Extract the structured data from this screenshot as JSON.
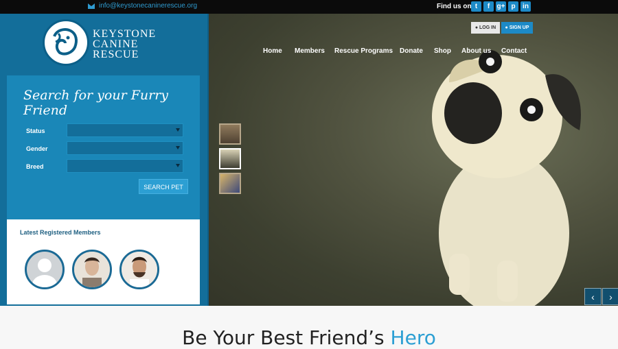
{
  "topbar": {
    "email": "info@keystonecaninerescue.org",
    "find_us": "Find us on:",
    "social": [
      {
        "icon": "twitter-icon",
        "glyph": "t"
      },
      {
        "icon": "facebook-icon",
        "glyph": "f"
      },
      {
        "icon": "google-plus-icon",
        "glyph": "g+"
      },
      {
        "icon": "pinterest-icon",
        "glyph": "p"
      },
      {
        "icon": "linkedin-icon",
        "glyph": "in"
      }
    ]
  },
  "logo": {
    "line1": "KEYSTONE",
    "line2": "CANINE",
    "line3": "RESCUE"
  },
  "search": {
    "title": "Search for your Furry Friend",
    "status_label": "Status",
    "gender_label": "Gender",
    "breed_label": "Breed",
    "button": "SEARCH PET"
  },
  "members": {
    "heading": "Latest Registered Members"
  },
  "auth": {
    "login": "LOG IN",
    "signup": "SIGN UP"
  },
  "nav": [
    "Home",
    "Members",
    "Rescue Programs",
    "Donate",
    "Shop",
    "About us",
    "Contact"
  ],
  "headline": {
    "main": "Be Your Best Friend’s ",
    "accent": "Hero"
  },
  "colors": {
    "brand_blue": "#136e9a",
    "accent_blue": "#2c9fd3",
    "topbar_bg": "#0b0b0b"
  }
}
